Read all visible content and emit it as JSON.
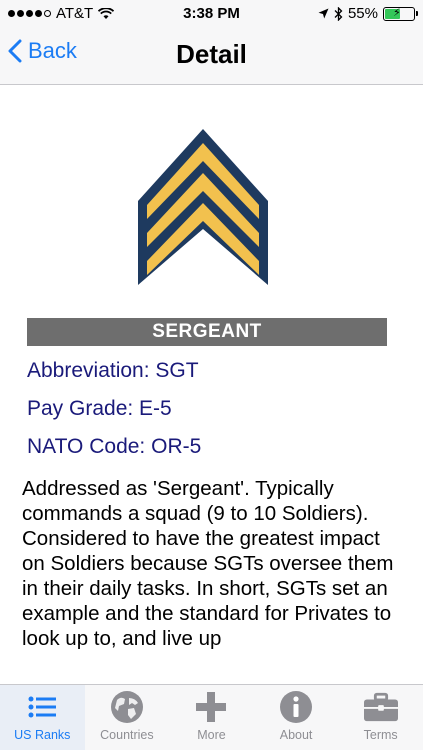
{
  "status_bar": {
    "carrier": "AT&T",
    "time": "3:38 PM",
    "battery_percent": "55%",
    "battery_level": 0.55
  },
  "nav": {
    "back_label": "Back",
    "title": "Detail"
  },
  "rank": {
    "name": "SERGEANT",
    "abbreviation": "Abbreviation: SGT",
    "pay_grade": "Pay Grade: E-5",
    "nato_code": "NATO Code: OR-5",
    "description": "Addressed as 'Sergeant'. Typically commands a squad (9 to 10 Soldiers). Considered to have the greatest impact on Soldiers because SGTs oversee them in their daily tasks. In short, SGTs set an example and the standard for Privates to look up to, and live up"
  },
  "tabs": [
    {
      "label": "US Ranks",
      "icon": "list-icon",
      "active": true
    },
    {
      "label": "Countries",
      "icon": "globe-icon",
      "active": false
    },
    {
      "label": "More",
      "icon": "plus-icon",
      "active": false
    },
    {
      "label": "About",
      "icon": "info-icon",
      "active": false
    },
    {
      "label": "Terms",
      "icon": "briefcase-icon",
      "active": false
    }
  ],
  "colors": {
    "accent": "#1b7cf4",
    "chevron_fill": "#f2c14e",
    "chevron_outline": "#1e3a5f",
    "rank_bar": "#6e6e6e",
    "info_text": "#1a1a7a"
  }
}
